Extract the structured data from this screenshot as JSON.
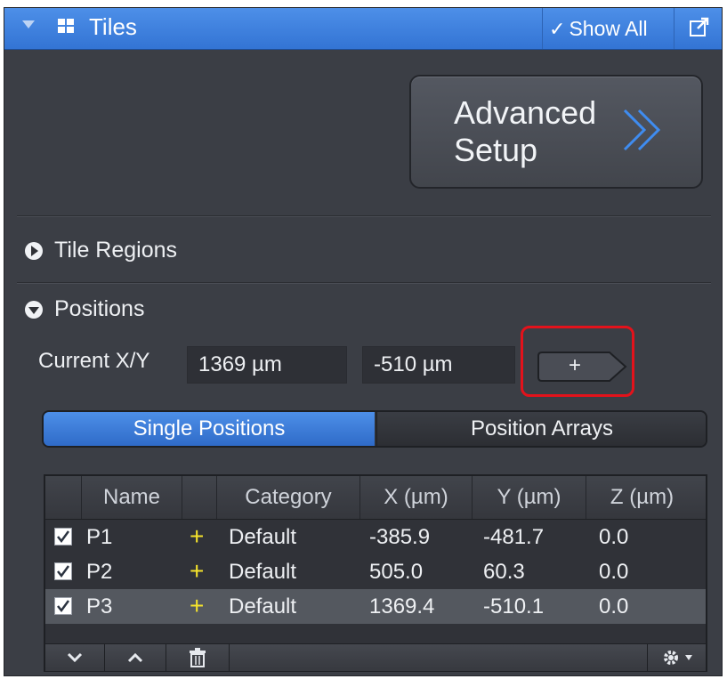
{
  "header": {
    "title": "Tiles",
    "show_all": "Show All"
  },
  "advanced_setup": {
    "label": "Advanced\nSetup"
  },
  "tile_regions": {
    "label": "Tile Regions"
  },
  "positions": {
    "label": "Positions",
    "current_label": "Current X/Y",
    "current_x": "1369 µm",
    "current_y": "-510 µm",
    "add_label": "+"
  },
  "tabs": {
    "single": "Single Positions",
    "arrays": "Position Arrays"
  },
  "table": {
    "headers": {
      "name": "Name",
      "category": "Category",
      "x": "X (µm)",
      "y": "Y (µm)",
      "z": "Z (µm)"
    },
    "rows": [
      {
        "checked": true,
        "name": "P1",
        "category": "Default",
        "x": "-385.9",
        "y": "-481.7",
        "z": "0.0"
      },
      {
        "checked": true,
        "name": "P2",
        "category": "Default",
        "x": "505.0",
        "y": "60.3",
        "z": "0.0"
      },
      {
        "checked": true,
        "name": "P3",
        "category": "Default",
        "x": "1369.4",
        "y": "-510.1",
        "z": "0.0",
        "selected": true
      }
    ],
    "marker_color": "#f5e32c"
  },
  "footer": {
    "icons": [
      "chevron-down-icon",
      "chevron-up-icon",
      "trash-icon",
      "gear-icon"
    ]
  },
  "colors": {
    "header_blue": "#3e82de",
    "panel_bg": "#3b3e45",
    "highlight_red": "#e3121b"
  }
}
